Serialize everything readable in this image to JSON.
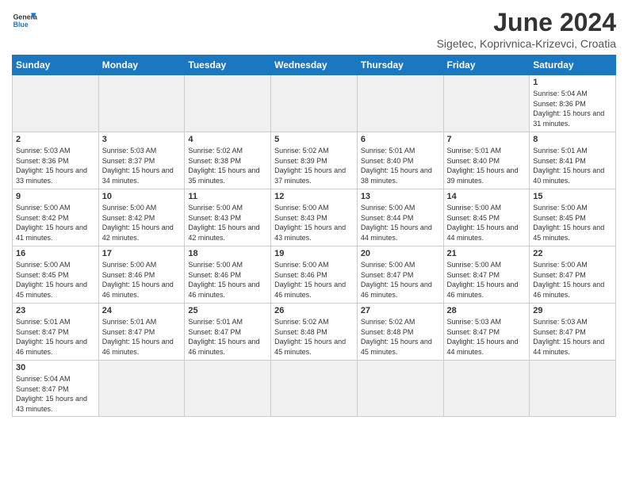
{
  "header": {
    "logo_general": "General",
    "logo_blue": "Blue",
    "title": "June 2024",
    "subtitle": "Sigetec, Koprivnica-Krizevci, Croatia"
  },
  "days_of_week": [
    "Sunday",
    "Monday",
    "Tuesday",
    "Wednesday",
    "Thursday",
    "Friday",
    "Saturday"
  ],
  "weeks": [
    [
      {
        "day": "",
        "empty": true
      },
      {
        "day": "",
        "empty": true
      },
      {
        "day": "",
        "empty": true
      },
      {
        "day": "",
        "empty": true
      },
      {
        "day": "",
        "empty": true
      },
      {
        "day": "",
        "empty": true
      },
      {
        "day": "1",
        "sunrise": "Sunrise: 5:04 AM",
        "sunset": "Sunset: 8:36 PM",
        "daylight": "Daylight: 15 hours and 31 minutes."
      }
    ],
    [
      {
        "day": "2",
        "sunrise": "Sunrise: 5:03 AM",
        "sunset": "Sunset: 8:36 PM",
        "daylight": "Daylight: 15 hours and 33 minutes."
      },
      {
        "day": "3",
        "sunrise": "Sunrise: 5:03 AM",
        "sunset": "Sunset: 8:37 PM",
        "daylight": "Daylight: 15 hours and 34 minutes."
      },
      {
        "day": "4",
        "sunrise": "Sunrise: 5:02 AM",
        "sunset": "Sunset: 8:38 PM",
        "daylight": "Daylight: 15 hours and 35 minutes."
      },
      {
        "day": "5",
        "sunrise": "Sunrise: 5:02 AM",
        "sunset": "Sunset: 8:39 PM",
        "daylight": "Daylight: 15 hours and 37 minutes."
      },
      {
        "day": "6",
        "sunrise": "Sunrise: 5:01 AM",
        "sunset": "Sunset: 8:40 PM",
        "daylight": "Daylight: 15 hours and 38 minutes."
      },
      {
        "day": "7",
        "sunrise": "Sunrise: 5:01 AM",
        "sunset": "Sunset: 8:40 PM",
        "daylight": "Daylight: 15 hours and 39 minutes."
      },
      {
        "day": "8",
        "sunrise": "Sunrise: 5:01 AM",
        "sunset": "Sunset: 8:41 PM",
        "daylight": "Daylight: 15 hours and 40 minutes."
      }
    ],
    [
      {
        "day": "9",
        "sunrise": "Sunrise: 5:00 AM",
        "sunset": "Sunset: 8:42 PM",
        "daylight": "Daylight: 15 hours and 41 minutes."
      },
      {
        "day": "10",
        "sunrise": "Sunrise: 5:00 AM",
        "sunset": "Sunset: 8:42 PM",
        "daylight": "Daylight: 15 hours and 42 minutes."
      },
      {
        "day": "11",
        "sunrise": "Sunrise: 5:00 AM",
        "sunset": "Sunset: 8:43 PM",
        "daylight": "Daylight: 15 hours and 42 minutes."
      },
      {
        "day": "12",
        "sunrise": "Sunrise: 5:00 AM",
        "sunset": "Sunset: 8:43 PM",
        "daylight": "Daylight: 15 hours and 43 minutes."
      },
      {
        "day": "13",
        "sunrise": "Sunrise: 5:00 AM",
        "sunset": "Sunset: 8:44 PM",
        "daylight": "Daylight: 15 hours and 44 minutes."
      },
      {
        "day": "14",
        "sunrise": "Sunrise: 5:00 AM",
        "sunset": "Sunset: 8:45 PM",
        "daylight": "Daylight: 15 hours and 44 minutes."
      },
      {
        "day": "15",
        "sunrise": "Sunrise: 5:00 AM",
        "sunset": "Sunset: 8:45 PM",
        "daylight": "Daylight: 15 hours and 45 minutes."
      }
    ],
    [
      {
        "day": "16",
        "sunrise": "Sunrise: 5:00 AM",
        "sunset": "Sunset: 8:45 PM",
        "daylight": "Daylight: 15 hours and 45 minutes."
      },
      {
        "day": "17",
        "sunrise": "Sunrise: 5:00 AM",
        "sunset": "Sunset: 8:46 PM",
        "daylight": "Daylight: 15 hours and 46 minutes."
      },
      {
        "day": "18",
        "sunrise": "Sunrise: 5:00 AM",
        "sunset": "Sunset: 8:46 PM",
        "daylight": "Daylight: 15 hours and 46 minutes."
      },
      {
        "day": "19",
        "sunrise": "Sunrise: 5:00 AM",
        "sunset": "Sunset: 8:46 PM",
        "daylight": "Daylight: 15 hours and 46 minutes."
      },
      {
        "day": "20",
        "sunrise": "Sunrise: 5:00 AM",
        "sunset": "Sunset: 8:47 PM",
        "daylight": "Daylight: 15 hours and 46 minutes."
      },
      {
        "day": "21",
        "sunrise": "Sunrise: 5:00 AM",
        "sunset": "Sunset: 8:47 PM",
        "daylight": "Daylight: 15 hours and 46 minutes."
      },
      {
        "day": "22",
        "sunrise": "Sunrise: 5:00 AM",
        "sunset": "Sunset: 8:47 PM",
        "daylight": "Daylight: 15 hours and 46 minutes."
      }
    ],
    [
      {
        "day": "23",
        "sunrise": "Sunrise: 5:01 AM",
        "sunset": "Sunset: 8:47 PM",
        "daylight": "Daylight: 15 hours and 46 minutes."
      },
      {
        "day": "24",
        "sunrise": "Sunrise: 5:01 AM",
        "sunset": "Sunset: 8:47 PM",
        "daylight": "Daylight: 15 hours and 46 minutes."
      },
      {
        "day": "25",
        "sunrise": "Sunrise: 5:01 AM",
        "sunset": "Sunset: 8:47 PM",
        "daylight": "Daylight: 15 hours and 46 minutes."
      },
      {
        "day": "26",
        "sunrise": "Sunrise: 5:02 AM",
        "sunset": "Sunset: 8:48 PM",
        "daylight": "Daylight: 15 hours and 45 minutes."
      },
      {
        "day": "27",
        "sunrise": "Sunrise: 5:02 AM",
        "sunset": "Sunset: 8:48 PM",
        "daylight": "Daylight: 15 hours and 45 minutes."
      },
      {
        "day": "28",
        "sunrise": "Sunrise: 5:03 AM",
        "sunset": "Sunset: 8:47 PM",
        "daylight": "Daylight: 15 hours and 44 minutes."
      },
      {
        "day": "29",
        "sunrise": "Sunrise: 5:03 AM",
        "sunset": "Sunset: 8:47 PM",
        "daylight": "Daylight: 15 hours and 44 minutes."
      }
    ],
    [
      {
        "day": "30",
        "sunrise": "Sunrise: 5:04 AM",
        "sunset": "Sunset: 8:47 PM",
        "daylight": "Daylight: 15 hours and 43 minutes."
      },
      {
        "day": "",
        "empty": true
      },
      {
        "day": "",
        "empty": true
      },
      {
        "day": "",
        "empty": true
      },
      {
        "day": "",
        "empty": true
      },
      {
        "day": "",
        "empty": true
      },
      {
        "day": "",
        "empty": true
      }
    ]
  ]
}
